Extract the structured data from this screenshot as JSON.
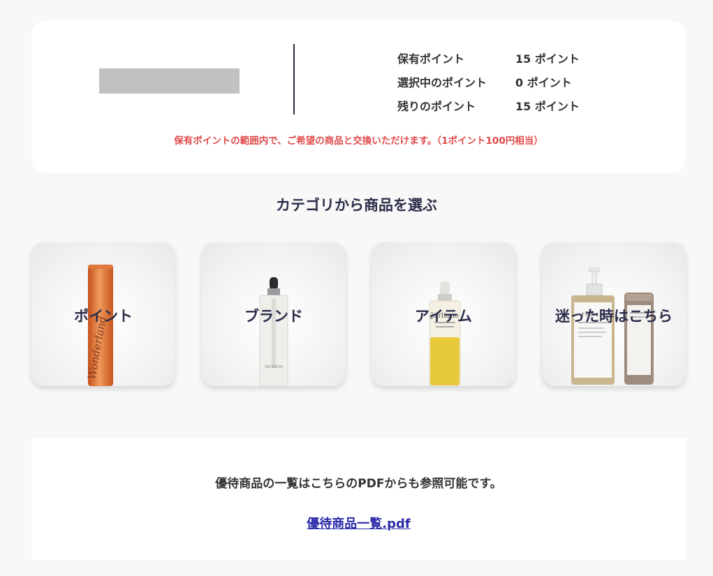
{
  "points": {
    "rows": [
      {
        "label": "保有ポイント",
        "value": "15 ポイント"
      },
      {
        "label": "選択中のポイント",
        "value": "0 ポイント"
      },
      {
        "label": "残りのポイント",
        "value": "15 ポイント"
      }
    ],
    "notice": "保有ポイントの範囲内で、ご希望の商品と交換いただけます。（1ポイント100円相当）"
  },
  "section_title": "カテゴリから商品を選ぶ",
  "categories": [
    {
      "label": "ポイント",
      "product": "Wonderland"
    },
    {
      "label": "ブランド",
      "product": "RECENCIA"
    },
    {
      "label": "アイテム",
      "product": "Jurlique"
    },
    {
      "label": "迷った時はこちら",
      "product": "THREE"
    }
  ],
  "pdf": {
    "text": "優待商品の一覧はこちらのPDFからも参照可能です。",
    "link": "優待商品一覧.pdf"
  },
  "colors": {
    "background": "#f8f8f8",
    "notice_red": "#e04a4a",
    "heading_navy": "#2b2d4a",
    "link_blue": "#2a2aa8"
  }
}
